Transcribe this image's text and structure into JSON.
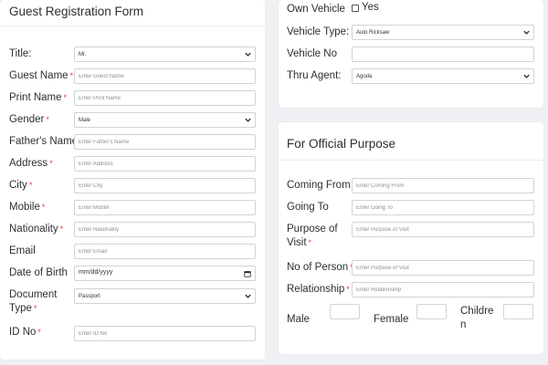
{
  "guest_form": {
    "title": "Guest Registration Form",
    "fields": [
      {
        "label": "Title:",
        "required": false,
        "type": "select",
        "value": "Mr."
      },
      {
        "label": "Guest Name",
        "required": true,
        "type": "text",
        "placeholder": "Enter Guest Name"
      },
      {
        "label": "Print Name",
        "required": true,
        "type": "text",
        "placeholder": "Enter Print Name"
      },
      {
        "label": "Gender",
        "required": true,
        "type": "select",
        "value": "Male"
      },
      {
        "label": "Father's Name",
        "required": false,
        "type": "text",
        "placeholder": "Enter Father's Name"
      },
      {
        "label": "Address",
        "required": true,
        "type": "text",
        "placeholder": "Enter Address"
      },
      {
        "label": "City",
        "required": true,
        "type": "text",
        "placeholder": "Enter City"
      },
      {
        "label": "Mobile",
        "required": true,
        "type": "text",
        "placeholder": "Enter Mobile"
      },
      {
        "label": "Nationality",
        "required": true,
        "type": "text",
        "placeholder": "Enter Nationality"
      },
      {
        "label": "Email",
        "required": false,
        "type": "text",
        "placeholder": "Enter Email"
      },
      {
        "label": "Date of Birth",
        "required": false,
        "type": "date",
        "value": "mm/dd/yyyy"
      },
      {
        "label_line1": "Document",
        "label_line2": "Type",
        "required": true,
        "type": "select",
        "value": "Passport"
      },
      {
        "label": "ID No",
        "required": true,
        "type": "text",
        "placeholder": "Enter ID No"
      }
    ]
  },
  "vehicle": {
    "own_vehicle_label": "Own Vehicle",
    "own_vehicle_option": "Yes",
    "own_vehicle_checked": false,
    "vehicle_type_label": "Vehicle Type:",
    "vehicle_type_value": "Auto Ricksaw",
    "vehicle_no_label": "Vehicle No",
    "vehicle_no_value": "",
    "thru_agent_label": "Thru Agent:",
    "thru_agent_value": "Agoda"
  },
  "official": {
    "title": "For Official Purpose",
    "coming_from_label": "Coming From",
    "coming_from_placeholder": "Enter Coming From",
    "going_to_label": "Going To",
    "going_to_placeholder": "Enter Going To",
    "purpose_label_line1": "Purpose of",
    "purpose_label_line2": "Visit",
    "purpose_placeholder": "Enter Purpose of Visit",
    "no_of_person_label": "No of Person",
    "no_of_person_placeholder": "Enter Purpose of Visit",
    "relationship_label": "Relationship",
    "relationship_placeholder": "Enter Relationship",
    "male_label": "Male",
    "female_label": "Female",
    "children_label_line1": "Childre",
    "children_label_line2": "n"
  },
  "required_mark": "*",
  "colors": {
    "required": "#e53935",
    "background": "#eef0f3",
    "card": "#ffffff",
    "border": "#ced4da"
  }
}
